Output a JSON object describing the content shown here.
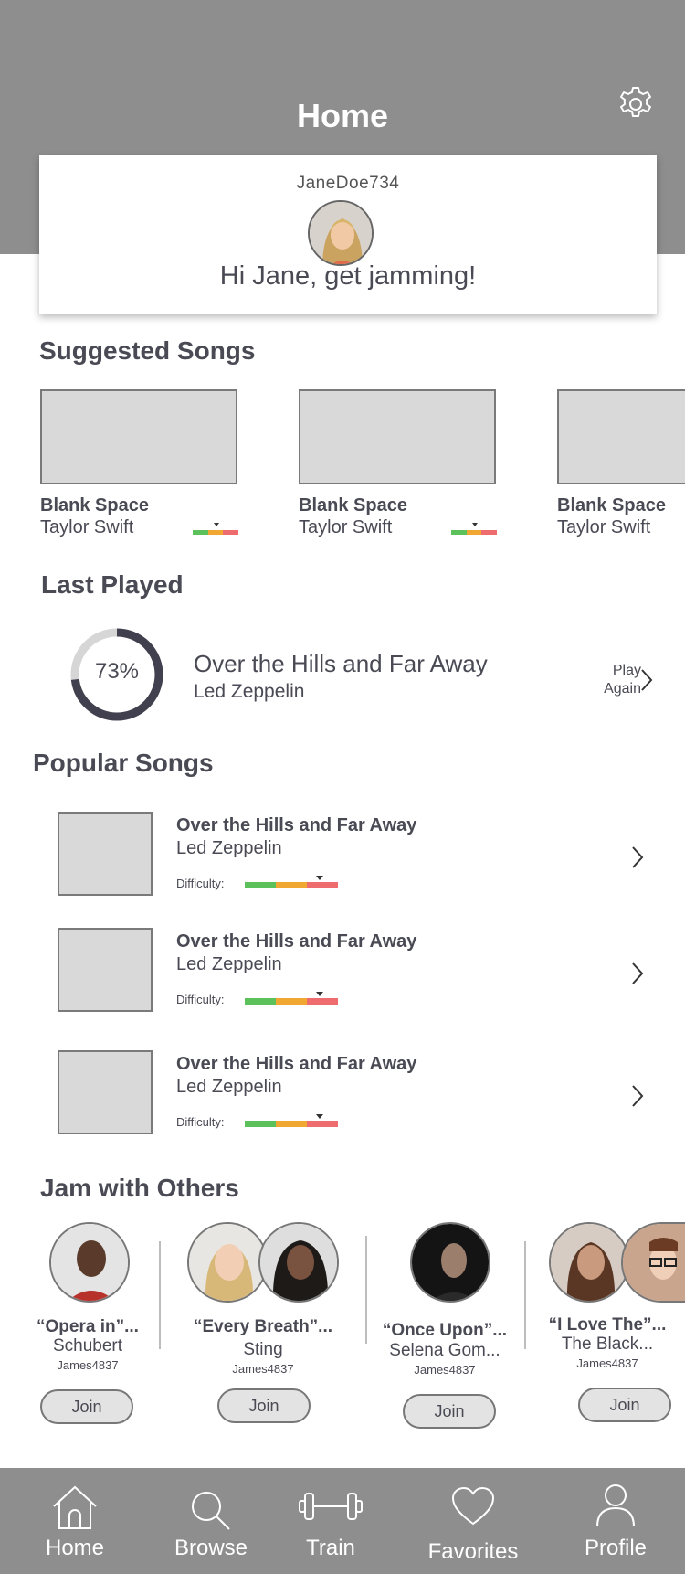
{
  "header": {
    "title": "Home"
  },
  "profile": {
    "username": "JaneDoe734",
    "greeting": "Hi Jane, get jamming!"
  },
  "suggested": {
    "title": "Suggested Songs",
    "items": [
      {
        "song": "Blank Space",
        "artist": "Taylor Swift"
      },
      {
        "song": "Blank Space",
        "artist": "Taylor Swift"
      },
      {
        "song": "Blank Space",
        "artist": "Taylor Swift"
      }
    ]
  },
  "last_played": {
    "title": "Last Played",
    "progress_label": "73%",
    "progress": 0.73,
    "song": "Over the Hills and Far Away",
    "artist": "Led Zeppelin",
    "action": "Play Again"
  },
  "popular": {
    "title": "Popular Songs",
    "items": [
      {
        "song": "Over the Hills and Far Away",
        "artist": "Led Zeppelin",
        "difficulty_label": "Difficulty:"
      },
      {
        "song": "Over the Hills and Far Away",
        "artist": "Led Zeppelin",
        "difficulty_label": "Difficulty:"
      },
      {
        "song": "Over the Hills and Far Away",
        "artist": "Led Zeppelin",
        "difficulty_label": "Difficulty:"
      }
    ]
  },
  "jam": {
    "title": "Jam with Others",
    "sessions": [
      {
        "song": "“Opera in”...",
        "artist": "Schubert",
        "user": "James4837",
        "join": "Join"
      },
      {
        "song": "“Every Breath”...",
        "artist": "Sting",
        "user": "James4837",
        "join": "Join"
      },
      {
        "song": "“Once Upon”...",
        "artist": "Selena Gom...",
        "user": "James4837",
        "join": "Join"
      },
      {
        "song": "“I Love The”...",
        "artist": "The Black...",
        "user": "James4837",
        "join": "Join"
      }
    ]
  },
  "nav": {
    "items": [
      {
        "label": "Home",
        "icon": "home-icon"
      },
      {
        "label": "Browse",
        "icon": "search-icon"
      },
      {
        "label": "Train",
        "icon": "dumbbell-icon"
      },
      {
        "label": "Favorites",
        "icon": "heart-icon"
      },
      {
        "label": "Profile",
        "icon": "person-icon"
      }
    ]
  },
  "colors": {
    "header": "#8e8e8e",
    "easy": "#5cc15a",
    "medium": "#f0a832",
    "hard": "#ee6b6e",
    "ring": "#40404f"
  }
}
